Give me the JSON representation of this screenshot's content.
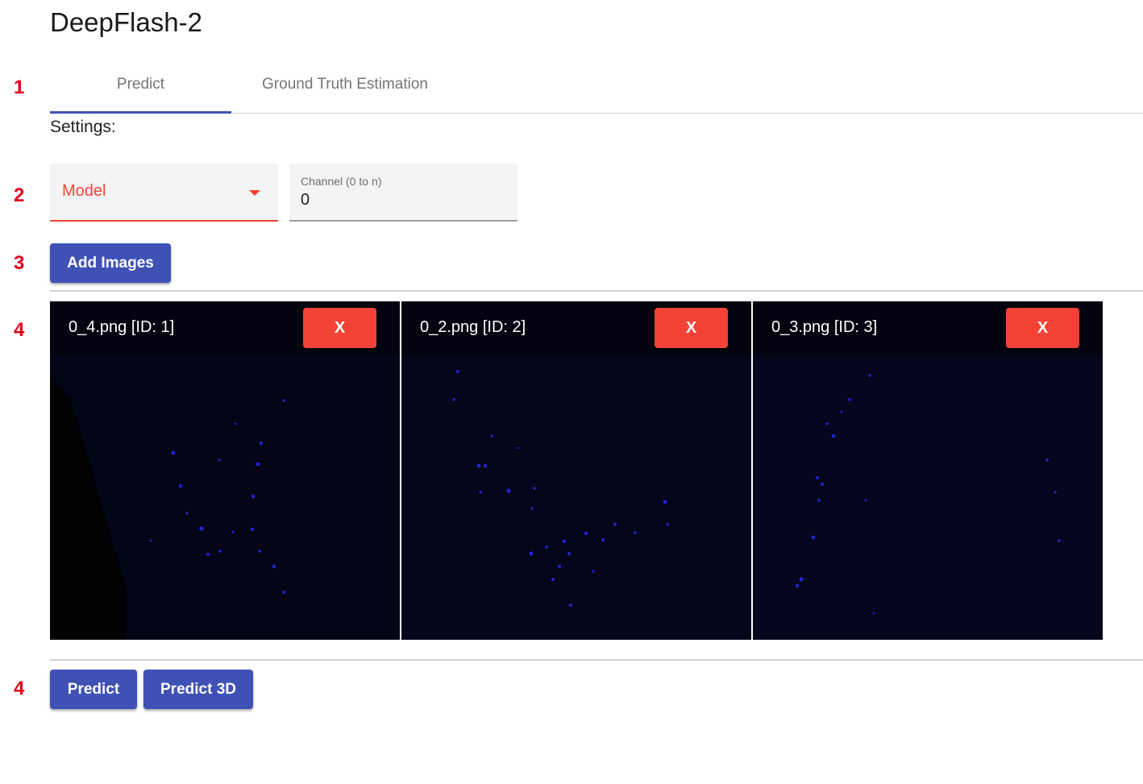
{
  "app": {
    "title": "DeepFlash-2"
  },
  "annotations": [
    "1",
    "2",
    "3",
    "4",
    "4"
  ],
  "tabs": [
    {
      "label": "Predict",
      "active": true
    },
    {
      "label": "Ground Truth Estimation",
      "active": false
    }
  ],
  "settings": {
    "label": "Settings:",
    "model_select": {
      "label": "Model"
    },
    "channel_field": {
      "label": "Channel (0 to n)",
      "value": "0"
    }
  },
  "add_images": {
    "label": "Add Images"
  },
  "images": [
    {
      "title": "0_4.png [ID: 1]",
      "remove_label": "X"
    },
    {
      "title": "0_2.png [ID: 2]",
      "remove_label": "X"
    },
    {
      "title": "0_3.png [ID: 3]",
      "remove_label": "X"
    }
  ],
  "actions": {
    "predict": "Predict",
    "predict_3d": "Predict 3D"
  },
  "colors": {
    "primary": "#3f51b5",
    "error": "#f44336",
    "annotation": "#e0001b",
    "image_background": "#04041a",
    "cell_dots": "#2a2aff"
  }
}
